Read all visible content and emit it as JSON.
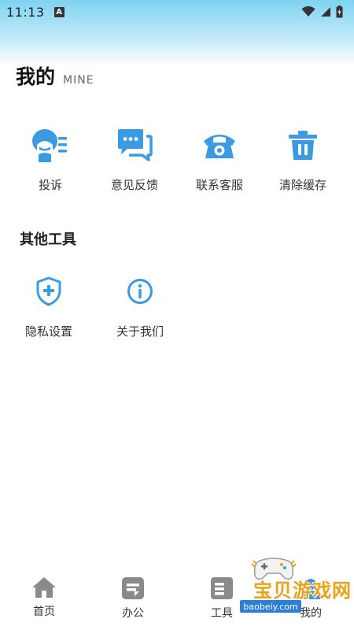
{
  "status_bar": {
    "time": "11:13",
    "badge": "A"
  },
  "header": {
    "title": "我的",
    "subtitle": "MINE"
  },
  "colors": {
    "accent": "#3a9be3",
    "gray_icon": "#8a8a8a",
    "watermark": "#e8a31a",
    "watermark_url_bg": "#2b7fd6"
  },
  "main_actions": [
    {
      "label": "投诉",
      "icon": "complaint-icon"
    },
    {
      "label": "意见反馈",
      "icon": "feedback-chat-icon"
    },
    {
      "label": "联系客服",
      "icon": "telephone-icon"
    },
    {
      "label": "清除缓存",
      "icon": "trash-icon"
    }
  ],
  "other_tools": {
    "title": "其他工具",
    "items": [
      {
        "label": "隐私设置",
        "icon": "shield-plus-icon"
      },
      {
        "label": "关于我们",
        "icon": "info-icon"
      }
    ]
  },
  "tab_bar": {
    "tabs": [
      {
        "label": "首页",
        "icon": "home-icon"
      },
      {
        "label": "办公",
        "icon": "office-icon"
      },
      {
        "label": "工具",
        "icon": "tools-icon"
      },
      {
        "label": "我的",
        "icon": "profile-icon"
      }
    ]
  },
  "watermark": {
    "name": "宝贝游戏网",
    "url": "baobeiy.com"
  }
}
